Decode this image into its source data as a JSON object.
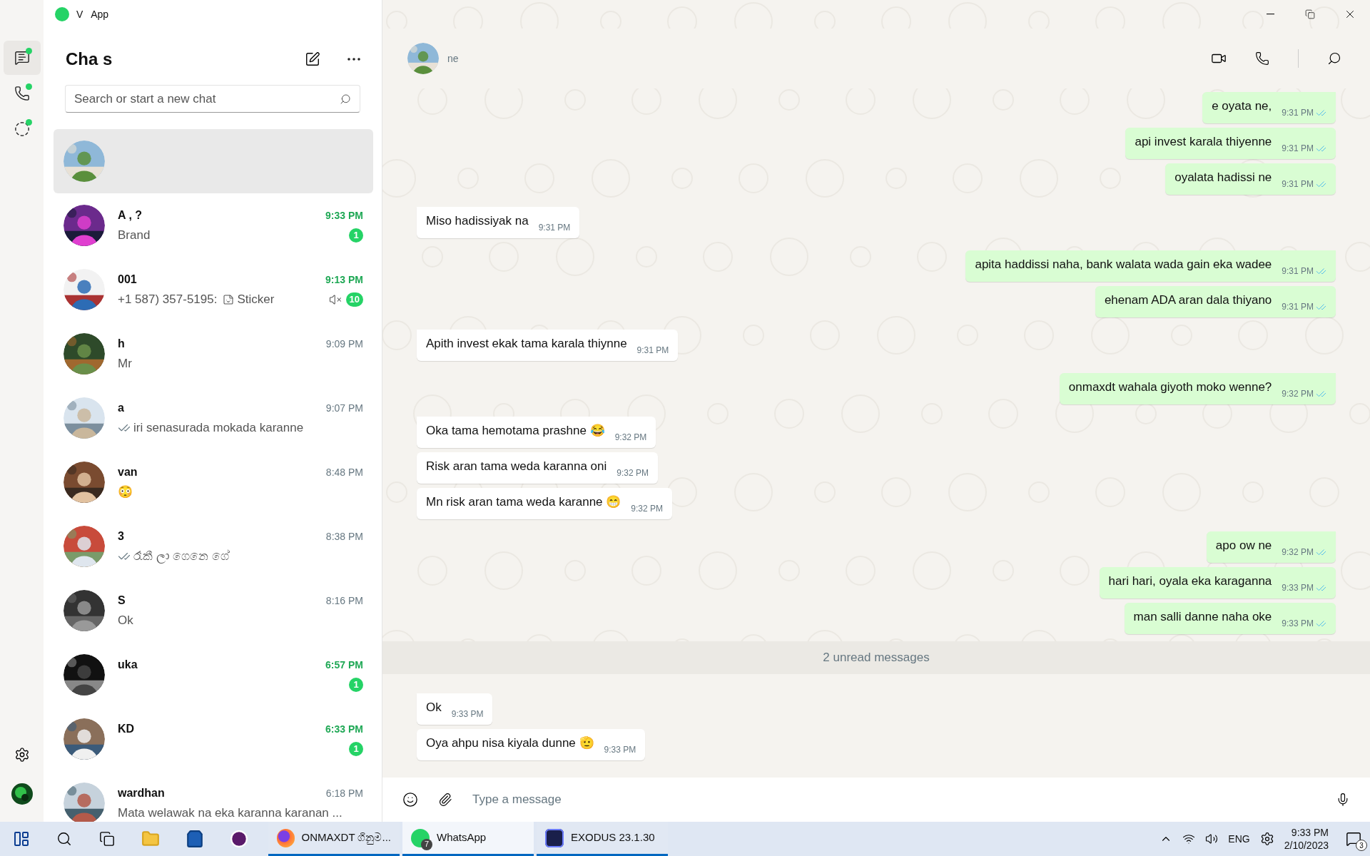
{
  "window": {
    "title": "V   App"
  },
  "rail": [
    {
      "kind": "chats",
      "selected": true,
      "dot": true
    },
    {
      "kind": "calls",
      "selected": false,
      "dot": true
    },
    {
      "kind": "status",
      "selected": false,
      "dot": true
    }
  ],
  "chat_list": {
    "title": "Cha s",
    "search": {
      "placeholder": "Search or start a new chat"
    },
    "rows": [
      {
        "selected": true,
        "muted": false,
        "ticks": false
      },
      {
        "selected": false,
        "name": "A , ?",
        "time": "9:33 PM",
        "preview": "Brand",
        "unread": "1",
        "muted": false,
        "ticks": false
      },
      {
        "selected": false,
        "name": "001",
        "time": "9:13 PM",
        "preview": "+1 587) 357-5195:",
        "media": "Sticker",
        "unread": "10",
        "muted": true,
        "ticks": false
      },
      {
        "selected": false,
        "name": "h",
        "time": "9:09 PM",
        "preview": "Mr",
        "muted": false,
        "ticks": false
      },
      {
        "selected": false,
        "name": "a",
        "time": "9:07 PM",
        "preview": "iri senasurada mokada karanne",
        "muted": false,
        "ticks": true
      },
      {
        "selected": false,
        "name": "van",
        "time": "8:48 PM",
        "preview": "😳",
        "muted": false,
        "ticks": false
      },
      {
        "selected": false,
        "name": "3",
        "time": "8:38 PM",
        "preview": "රෑකී ලා ගෙනෙ ගේ",
        "muted": false,
        "ticks": true
      },
      {
        "selected": false,
        "name": "S",
        "time": "8:16 PM",
        "preview": "Ok",
        "muted": false,
        "ticks": false
      },
      {
        "selected": false,
        "name": "uka",
        "time": "6:57 PM",
        "unread": "1",
        "muted": false,
        "ticks": false
      },
      {
        "selected": false,
        "name": "KD",
        "time": "6:33 PM",
        "unread": "1",
        "muted": false,
        "ticks": false
      },
      {
        "selected": false,
        "name": "wardhan",
        "time": "6:18 PM",
        "preview": "Mata welawak na eka karanna karanan ...",
        "muted": false,
        "ticks": false
      }
    ]
  },
  "conversation": {
    "contact": {
      "status": "ne"
    },
    "messages": [
      {
        "kind": "out",
        "text": "e oyata ne,",
        "time": "9:31 PM",
        "read": true,
        "group_start": true
      },
      {
        "kind": "out",
        "text": "api invest karala thiyenne",
        "time": "9:31 PM",
        "read": true,
        "group_start": false
      },
      {
        "kind": "out",
        "text": "oyalata hadissi ne",
        "time": "9:31 PM",
        "read": true,
        "group_start": false
      },
      {
        "kind": "in",
        "text": "Miso hadissiyak na",
        "time": "9:31 PM",
        "group_start": true
      },
      {
        "kind": "out",
        "text": "apita haddissi naha, bank walata wada gain eka wadee",
        "time": "9:31 PM",
        "read": true,
        "group_start": true
      },
      {
        "kind": "out",
        "text": "ehenam ADA aran dala thiyano",
        "time": "9:31 PM",
        "read": true,
        "group_start": false
      },
      {
        "kind": "in",
        "text": "Apith invest ekak tama karala thiynne",
        "time": "9:31 PM",
        "group_start": true
      },
      {
        "kind": "out",
        "text": "onmaxdt wahala giyoth moko wenne?",
        "time": "9:32 PM",
        "read": true,
        "group_start": true
      },
      {
        "kind": "in",
        "text": "Oka tama hemotama prashne 😂",
        "time": "9:32 PM",
        "group_start": true
      },
      {
        "kind": "in",
        "text": "Risk aran tama weda karanna oni",
        "time": "9:32 PM",
        "group_start": false
      },
      {
        "kind": "in",
        "text": "Mn risk aran tama weda karanne 😁",
        "time": "9:32 PM",
        "group_start": false
      },
      {
        "kind": "out",
        "text": "apo ow ne",
        "time": "9:32 PM",
        "read": true,
        "group_start": true
      },
      {
        "kind": "out",
        "text": "hari hari, oyala eka karaganna",
        "time": "9:33 PM",
        "read": true,
        "group_start": false
      },
      {
        "kind": "out",
        "text": "man salli danne naha oke",
        "time": "9:33 PM",
        "read": true,
        "group_start": false
      },
      {
        "kind": "divider",
        "text": "2 unread messages"
      },
      {
        "kind": "in",
        "text": "Ok",
        "time": "9:33 PM",
        "group_start": true
      },
      {
        "kind": "in",
        "text": "Oya ahpu nisa kiyala dunne 🫡",
        "time": "9:33 PM",
        "group_start": false
      }
    ],
    "composer": {
      "placeholder": "Type a message"
    }
  },
  "taskbar": {
    "apps": [
      {
        "kind": "firefox",
        "label": "ONMAXDT ගිනුම...",
        "selected": false
      },
      {
        "kind": "whatsapp",
        "label": "WhatsApp",
        "badge": "7",
        "selected": true
      },
      {
        "kind": "exodus",
        "label": "EXODUS 23.1.30",
        "selected": false
      }
    ],
    "language": "ENG",
    "time": "9:33 PM",
    "date": "2/10/2023",
    "notifications": "3"
  }
}
